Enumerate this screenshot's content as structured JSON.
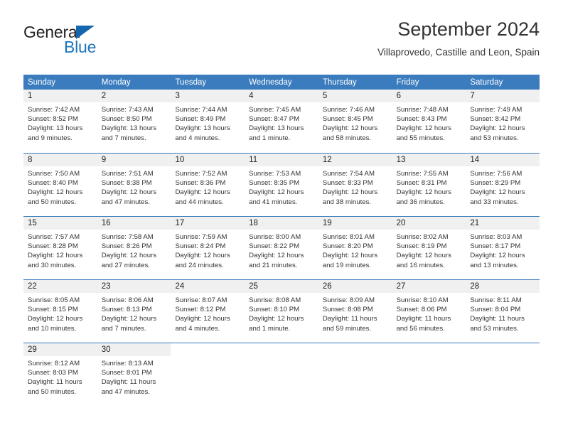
{
  "logo": {
    "word_top": "General",
    "word_bottom": "Blue",
    "triangle_color": "#1466ad",
    "blue_color": "#1c75bc"
  },
  "header": {
    "title": "September 2024",
    "subtitle": "Villaprovedo, Castille and Leon, Spain"
  },
  "theme": {
    "header_blue": "#3a7cbe",
    "daynum_band": "#f0f0f0"
  },
  "weekdays": [
    "Sunday",
    "Monday",
    "Tuesday",
    "Wednesday",
    "Thursday",
    "Friday",
    "Saturday"
  ],
  "labels": {
    "sunrise": "Sunrise:",
    "sunset": "Sunset:",
    "daylight": "Daylight:"
  },
  "weeks": [
    [
      {
        "day": "1",
        "sunrise": "Sunrise: 7:42 AM",
        "sunset": "Sunset: 8:52 PM",
        "daylight_1": "Daylight: 13 hours",
        "daylight_2": "and 9 minutes."
      },
      {
        "day": "2",
        "sunrise": "Sunrise: 7:43 AM",
        "sunset": "Sunset: 8:50 PM",
        "daylight_1": "Daylight: 13 hours",
        "daylight_2": "and 7 minutes."
      },
      {
        "day": "3",
        "sunrise": "Sunrise: 7:44 AM",
        "sunset": "Sunset: 8:49 PM",
        "daylight_1": "Daylight: 13 hours",
        "daylight_2": "and 4 minutes."
      },
      {
        "day": "4",
        "sunrise": "Sunrise: 7:45 AM",
        "sunset": "Sunset: 8:47 PM",
        "daylight_1": "Daylight: 13 hours",
        "daylight_2": "and 1 minute."
      },
      {
        "day": "5",
        "sunrise": "Sunrise: 7:46 AM",
        "sunset": "Sunset: 8:45 PM",
        "daylight_1": "Daylight: 12 hours",
        "daylight_2": "and 58 minutes."
      },
      {
        "day": "6",
        "sunrise": "Sunrise: 7:48 AM",
        "sunset": "Sunset: 8:43 PM",
        "daylight_1": "Daylight: 12 hours",
        "daylight_2": "and 55 minutes."
      },
      {
        "day": "7",
        "sunrise": "Sunrise: 7:49 AM",
        "sunset": "Sunset: 8:42 PM",
        "daylight_1": "Daylight: 12 hours",
        "daylight_2": "and 53 minutes."
      }
    ],
    [
      {
        "day": "8",
        "sunrise": "Sunrise: 7:50 AM",
        "sunset": "Sunset: 8:40 PM",
        "daylight_1": "Daylight: 12 hours",
        "daylight_2": "and 50 minutes."
      },
      {
        "day": "9",
        "sunrise": "Sunrise: 7:51 AM",
        "sunset": "Sunset: 8:38 PM",
        "daylight_1": "Daylight: 12 hours",
        "daylight_2": "and 47 minutes."
      },
      {
        "day": "10",
        "sunrise": "Sunrise: 7:52 AM",
        "sunset": "Sunset: 8:36 PM",
        "daylight_1": "Daylight: 12 hours",
        "daylight_2": "and 44 minutes."
      },
      {
        "day": "11",
        "sunrise": "Sunrise: 7:53 AM",
        "sunset": "Sunset: 8:35 PM",
        "daylight_1": "Daylight: 12 hours",
        "daylight_2": "and 41 minutes."
      },
      {
        "day": "12",
        "sunrise": "Sunrise: 7:54 AM",
        "sunset": "Sunset: 8:33 PM",
        "daylight_1": "Daylight: 12 hours",
        "daylight_2": "and 38 minutes."
      },
      {
        "day": "13",
        "sunrise": "Sunrise: 7:55 AM",
        "sunset": "Sunset: 8:31 PM",
        "daylight_1": "Daylight: 12 hours",
        "daylight_2": "and 36 minutes."
      },
      {
        "day": "14",
        "sunrise": "Sunrise: 7:56 AM",
        "sunset": "Sunset: 8:29 PM",
        "daylight_1": "Daylight: 12 hours",
        "daylight_2": "and 33 minutes."
      }
    ],
    [
      {
        "day": "15",
        "sunrise": "Sunrise: 7:57 AM",
        "sunset": "Sunset: 8:28 PM",
        "daylight_1": "Daylight: 12 hours",
        "daylight_2": "and 30 minutes."
      },
      {
        "day": "16",
        "sunrise": "Sunrise: 7:58 AM",
        "sunset": "Sunset: 8:26 PM",
        "daylight_1": "Daylight: 12 hours",
        "daylight_2": "and 27 minutes."
      },
      {
        "day": "17",
        "sunrise": "Sunrise: 7:59 AM",
        "sunset": "Sunset: 8:24 PM",
        "daylight_1": "Daylight: 12 hours",
        "daylight_2": "and 24 minutes."
      },
      {
        "day": "18",
        "sunrise": "Sunrise: 8:00 AM",
        "sunset": "Sunset: 8:22 PM",
        "daylight_1": "Daylight: 12 hours",
        "daylight_2": "and 21 minutes."
      },
      {
        "day": "19",
        "sunrise": "Sunrise: 8:01 AM",
        "sunset": "Sunset: 8:20 PM",
        "daylight_1": "Daylight: 12 hours",
        "daylight_2": "and 19 minutes."
      },
      {
        "day": "20",
        "sunrise": "Sunrise: 8:02 AM",
        "sunset": "Sunset: 8:19 PM",
        "daylight_1": "Daylight: 12 hours",
        "daylight_2": "and 16 minutes."
      },
      {
        "day": "21",
        "sunrise": "Sunrise: 8:03 AM",
        "sunset": "Sunset: 8:17 PM",
        "daylight_1": "Daylight: 12 hours",
        "daylight_2": "and 13 minutes."
      }
    ],
    [
      {
        "day": "22",
        "sunrise": "Sunrise: 8:05 AM",
        "sunset": "Sunset: 8:15 PM",
        "daylight_1": "Daylight: 12 hours",
        "daylight_2": "and 10 minutes."
      },
      {
        "day": "23",
        "sunrise": "Sunrise: 8:06 AM",
        "sunset": "Sunset: 8:13 PM",
        "daylight_1": "Daylight: 12 hours",
        "daylight_2": "and 7 minutes."
      },
      {
        "day": "24",
        "sunrise": "Sunrise: 8:07 AM",
        "sunset": "Sunset: 8:12 PM",
        "daylight_1": "Daylight: 12 hours",
        "daylight_2": "and 4 minutes."
      },
      {
        "day": "25",
        "sunrise": "Sunrise: 8:08 AM",
        "sunset": "Sunset: 8:10 PM",
        "daylight_1": "Daylight: 12 hours",
        "daylight_2": "and 1 minute."
      },
      {
        "day": "26",
        "sunrise": "Sunrise: 8:09 AM",
        "sunset": "Sunset: 8:08 PM",
        "daylight_1": "Daylight: 11 hours",
        "daylight_2": "and 59 minutes."
      },
      {
        "day": "27",
        "sunrise": "Sunrise: 8:10 AM",
        "sunset": "Sunset: 8:06 PM",
        "daylight_1": "Daylight: 11 hours",
        "daylight_2": "and 56 minutes."
      },
      {
        "day": "28",
        "sunrise": "Sunrise: 8:11 AM",
        "sunset": "Sunset: 8:04 PM",
        "daylight_1": "Daylight: 11 hours",
        "daylight_2": "and 53 minutes."
      }
    ],
    [
      {
        "day": "29",
        "sunrise": "Sunrise: 8:12 AM",
        "sunset": "Sunset: 8:03 PM",
        "daylight_1": "Daylight: 11 hours",
        "daylight_2": "and 50 minutes."
      },
      {
        "day": "30",
        "sunrise": "Sunrise: 8:13 AM",
        "sunset": "Sunset: 8:01 PM",
        "daylight_1": "Daylight: 11 hours",
        "daylight_2": "and 47 minutes."
      },
      {
        "day": "",
        "sunrise": "",
        "sunset": "",
        "daylight_1": "",
        "daylight_2": ""
      },
      {
        "day": "",
        "sunrise": "",
        "sunset": "",
        "daylight_1": "",
        "daylight_2": ""
      },
      {
        "day": "",
        "sunrise": "",
        "sunset": "",
        "daylight_1": "",
        "daylight_2": ""
      },
      {
        "day": "",
        "sunrise": "",
        "sunset": "",
        "daylight_1": "",
        "daylight_2": ""
      },
      {
        "day": "",
        "sunrise": "",
        "sunset": "",
        "daylight_1": "",
        "daylight_2": ""
      }
    ]
  ]
}
